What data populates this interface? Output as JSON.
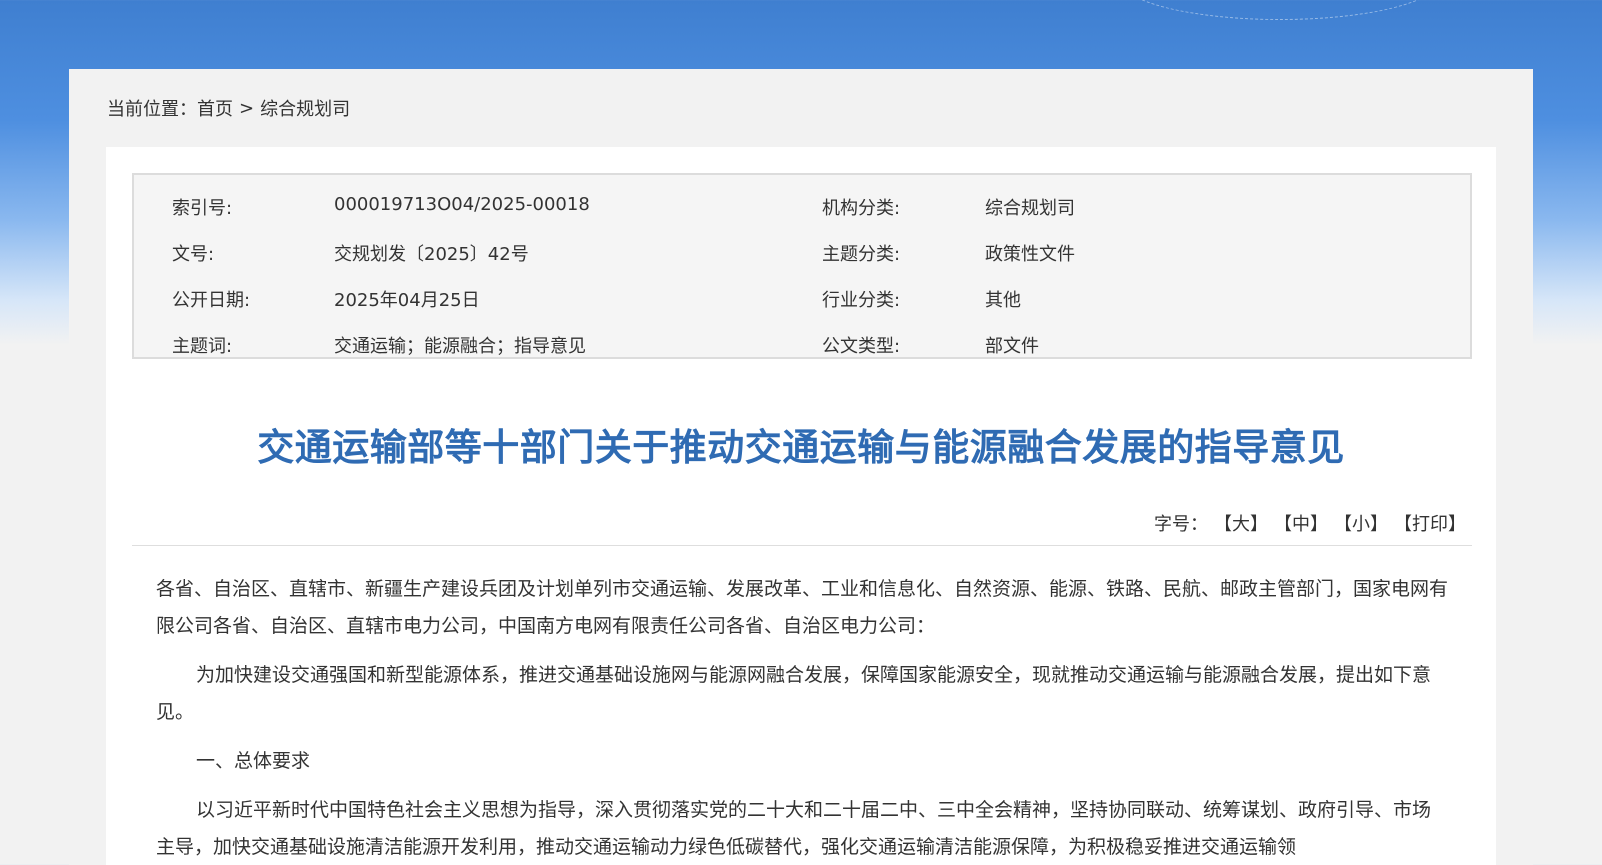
{
  "breadcrumb": {
    "prefix": "当前位置：",
    "home": "首页",
    "separator": ">",
    "current": "综合规划司"
  },
  "meta": {
    "rows": [
      {
        "k1": "索引号:",
        "v1": "000019713O04/2025-00018",
        "k2": "机构分类:",
        "v2": "综合规划司"
      },
      {
        "k1": "文号:",
        "v1": "交规划发〔2025〕42号",
        "k2": "主题分类:",
        "v2": "政策性文件"
      },
      {
        "k1": "公开日期:",
        "v1": "2025年04月25日",
        "k2": "行业分类:",
        "v2": "其他"
      },
      {
        "k1": "主题词:",
        "v1": "交通运输；能源融合；指导意见",
        "k2": "公文类型:",
        "v2": "部文件"
      }
    ]
  },
  "title": "交通运输部等十部门关于推动交通运输与能源融合发展的指导意见",
  "fontsize": {
    "label": "字号：",
    "large": "【大】",
    "medium": "【中】",
    "small": "【小】",
    "print": "【打印】"
  },
  "body": {
    "p1": "各省、自治区、直辖市、新疆生产建设兵团及计划单列市交通运输、发展改革、工业和信息化、自然资源、能源、铁路、民航、邮政主管部门，国家电网有限公司各省、自治区、直辖市电力公司，中国南方电网有限责任公司各省、自治区电力公司：",
    "p2": "为加快建设交通强国和新型能源体系，推进交通基础设施网与能源网融合发展，保障国家能源安全，现就推动交通运输与能源融合发展，提出如下意见。",
    "p3": "一、总体要求",
    "p4": "以习近平新时代中国特色社会主义思想为指导，深入贯彻落实党的二十大和二十届二中、三中全会精神，坚持协同联动、统筹谋划、政府引导、市场主导，加快交通基础设施清洁能源开发利用，推动交通运输动力绿色低碳替代，强化交通运输清洁能源保障，为积极稳妥推进交通运输领"
  }
}
